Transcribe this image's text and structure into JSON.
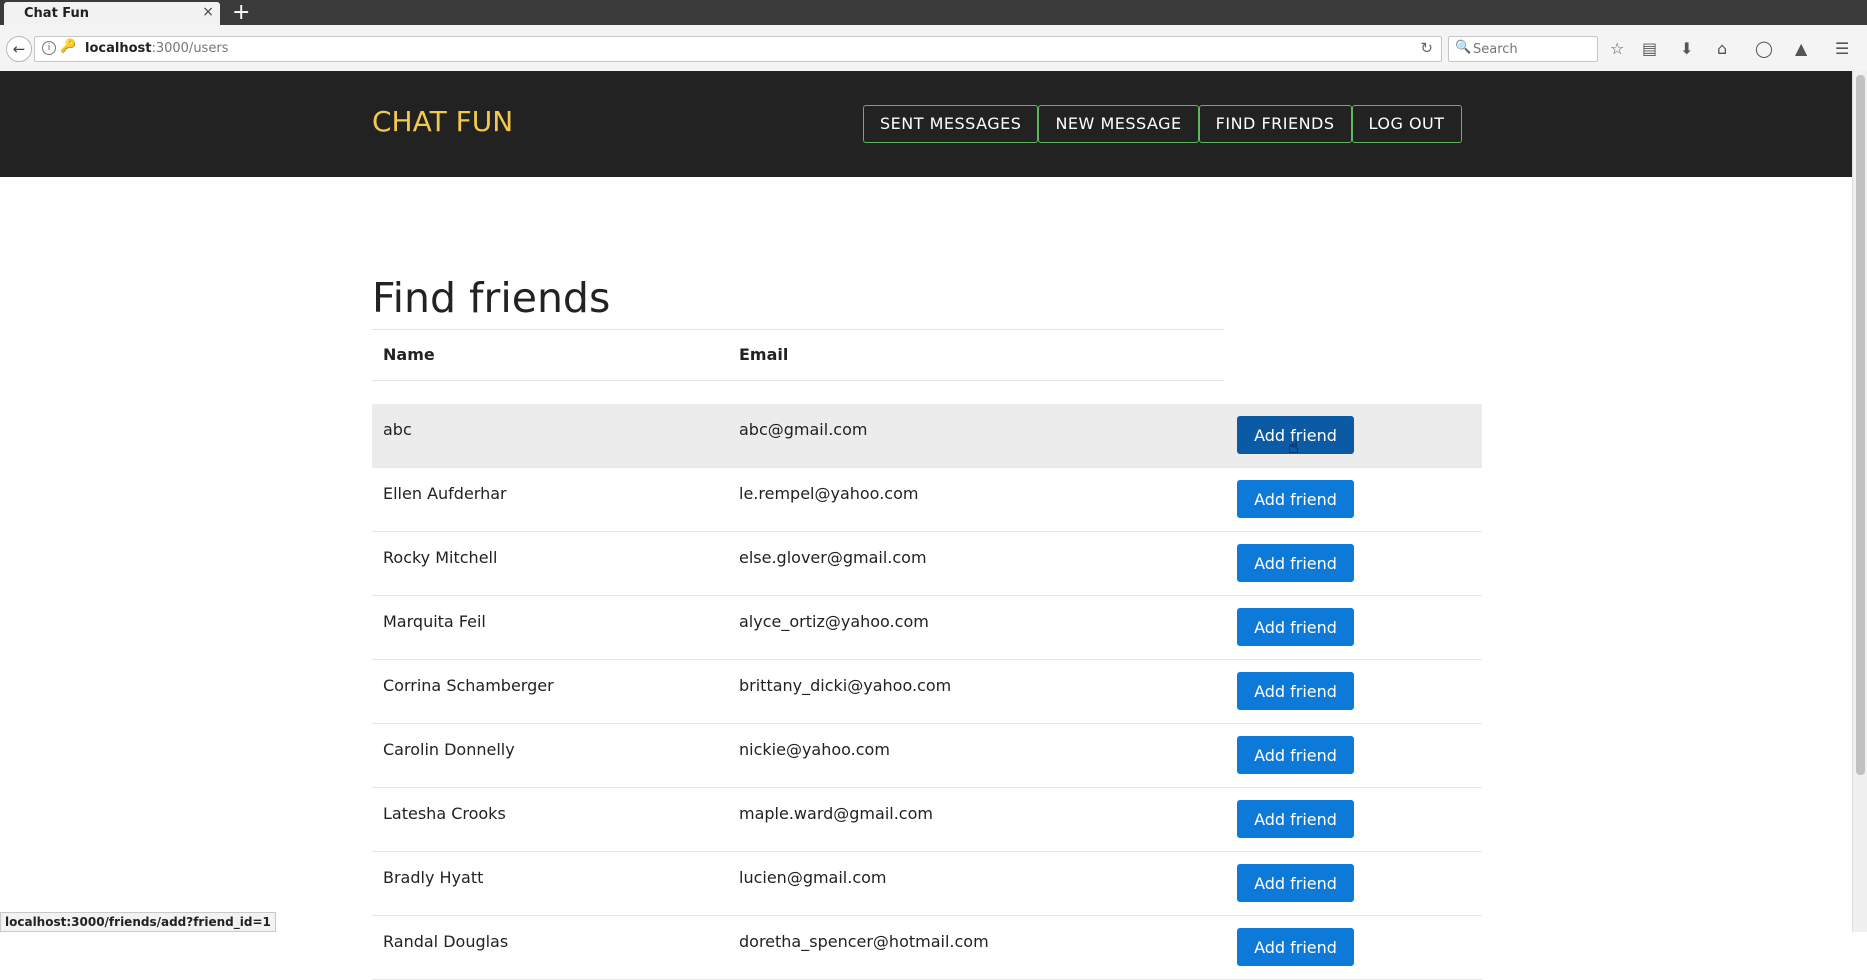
{
  "browser": {
    "tab_title": "Chat Fun",
    "tab_close": "×",
    "new_tab": "+",
    "url_host": "localhost",
    "url_path": ":3000/users",
    "search_placeholder": "Search",
    "status_url": "localhost:3000/friends/add?friend_id=1"
  },
  "app": {
    "brand": "CHAT FUN",
    "nav": [
      {
        "label": "SENT MESSAGES"
      },
      {
        "label": "NEW MESSAGE"
      },
      {
        "label": "FIND FRIENDS"
      },
      {
        "label": "LOG OUT"
      }
    ],
    "page_title": "Find friends",
    "columns": {
      "name": "Name",
      "email": "Email"
    },
    "button_label": "Add friend",
    "users": [
      {
        "name": "abc",
        "email": "abc@gmail.com"
      },
      {
        "name": "Ellen Aufderhar",
        "email": "le.rempel@yahoo.com"
      },
      {
        "name": "Rocky Mitchell",
        "email": "else.glover@gmail.com"
      },
      {
        "name": "Marquita Feil",
        "email": "alyce_ortiz@yahoo.com"
      },
      {
        "name": "Corrina Schamberger",
        "email": "brittany_dicki@yahoo.com"
      },
      {
        "name": "Carolin Donnelly",
        "email": "nickie@yahoo.com"
      },
      {
        "name": "Latesha Crooks",
        "email": "maple.ward@gmail.com"
      },
      {
        "name": "Bradly Hyatt",
        "email": "lucien@gmail.com"
      },
      {
        "name": "Randal Douglas",
        "email": "doretha_spencer@hotmail.com"
      }
    ]
  }
}
